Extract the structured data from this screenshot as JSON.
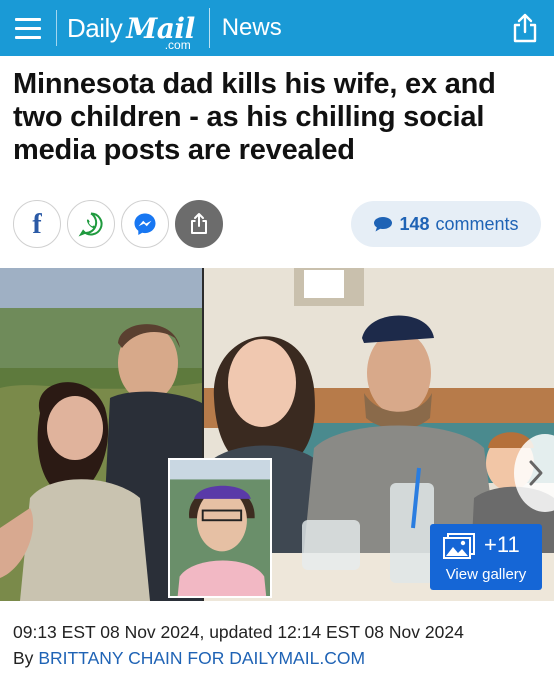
{
  "header": {
    "logo_daily": "Daily",
    "logo_mail": "Mail",
    "logo_com": ".com",
    "section": "News",
    "menu_icon": "hamburger-menu-icon",
    "share_icon": "share-icon",
    "background_color": "#1a9ad6"
  },
  "article": {
    "headline": "Minnesota dad kills his wife, ex and two children - as his chilling social media posts are revealed",
    "share_buttons": [
      {
        "name": "facebook",
        "icon": "facebook-icon"
      },
      {
        "name": "whatsapp",
        "icon": "whatsapp-icon"
      },
      {
        "name": "messenger",
        "icon": "messenger-icon"
      },
      {
        "name": "share",
        "icon": "share-icon"
      }
    ],
    "comments": {
      "count": "148",
      "label": "comments",
      "icon": "speech-bubble-icon"
    },
    "gallery": {
      "count": "+11",
      "label": "View gallery",
      "icon": "gallery-icon",
      "next_icon": "chevron-right-icon"
    },
    "dateline": "09:13 EST 08 Nov 2024, updated 12:14 EST 08 Nov 2024",
    "byline_prefix": "By",
    "author": "BRITTANY CHAIN FOR DAILYMAIL.COM"
  },
  "colors": {
    "accent_blue": "#1f63b5",
    "gallery_blue": "#1566d6",
    "comments_bg": "#e6eef6"
  }
}
